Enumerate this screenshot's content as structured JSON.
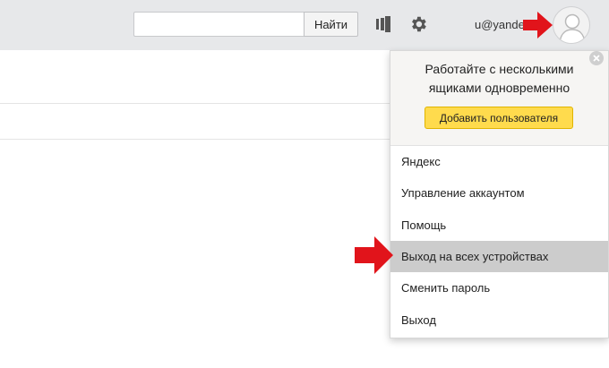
{
  "header": {
    "search": {
      "value": "",
      "placeholder": "",
      "button_label": "Найти"
    },
    "icons": [
      "subscriptions-icon",
      "gear-icon"
    ],
    "username": "u@yande",
    "avatar": "user-avatar-icon"
  },
  "dropdown": {
    "promo": {
      "title": "Работайте с несколькими ящиками одновременно",
      "add_user_label": "Добавить пользователя"
    },
    "menu": [
      {
        "label": "Яндекс"
      },
      {
        "label": "Управление аккаунтом"
      },
      {
        "label": "Помощь"
      },
      {
        "label": "Выход на всех устройствах",
        "active": true
      },
      {
        "label": "Сменить пароль"
      },
      {
        "label": "Выход"
      }
    ]
  },
  "colors": {
    "header_bg": "#e7e8ea",
    "accent_yellow": "#ffdb4d",
    "highlight": "#cccccc",
    "annotation_red": "#e1141b"
  }
}
